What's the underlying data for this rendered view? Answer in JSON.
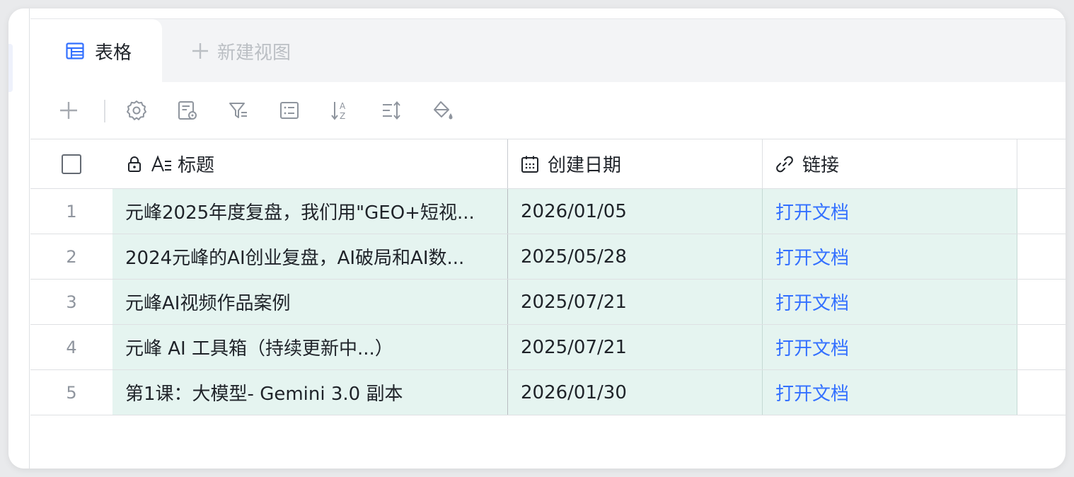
{
  "tabs": {
    "active_label": "表格",
    "new_view_label": "新建视图"
  },
  "toolbar": {
    "icons": [
      "plus-icon",
      "settings-icon",
      "form-settings-icon",
      "filter-icon",
      "group-icon",
      "sort-icon",
      "row-height-icon",
      "color-fill-icon"
    ]
  },
  "table": {
    "columns": [
      {
        "label": "标题",
        "icon": "text-lines-icon"
      },
      {
        "label": "创建日期",
        "icon": "calendar-icon"
      },
      {
        "label": "链接",
        "icon": "link-icon"
      }
    ],
    "rows": [
      {
        "num": "1",
        "title": "元峰2025年度复盘，我们用\"GEO+短视...",
        "date": "2026/01/05",
        "link": "打开文档"
      },
      {
        "num": "2",
        "title": "2024元峰的AI创业复盘，AI破局和AI数...",
        "date": "2025/05/28",
        "link": "打开文档"
      },
      {
        "num": "3",
        "title": "元峰AI视频作品案例",
        "date": "2025/07/21",
        "link": "打开文档"
      },
      {
        "num": "4",
        "title": "元峰 AI 工具箱（持续更新中...）",
        "date": "2025/07/21",
        "link": "打开文档"
      },
      {
        "num": "5",
        "title": "第1课：大模型- Gemini 3.0 副本",
        "date": "2026/01/30",
        "link": "打开文档"
      }
    ]
  },
  "colors": {
    "accent": "#3370ff",
    "row_highlight": "#e5f4f0",
    "border": "#dee0e3"
  }
}
